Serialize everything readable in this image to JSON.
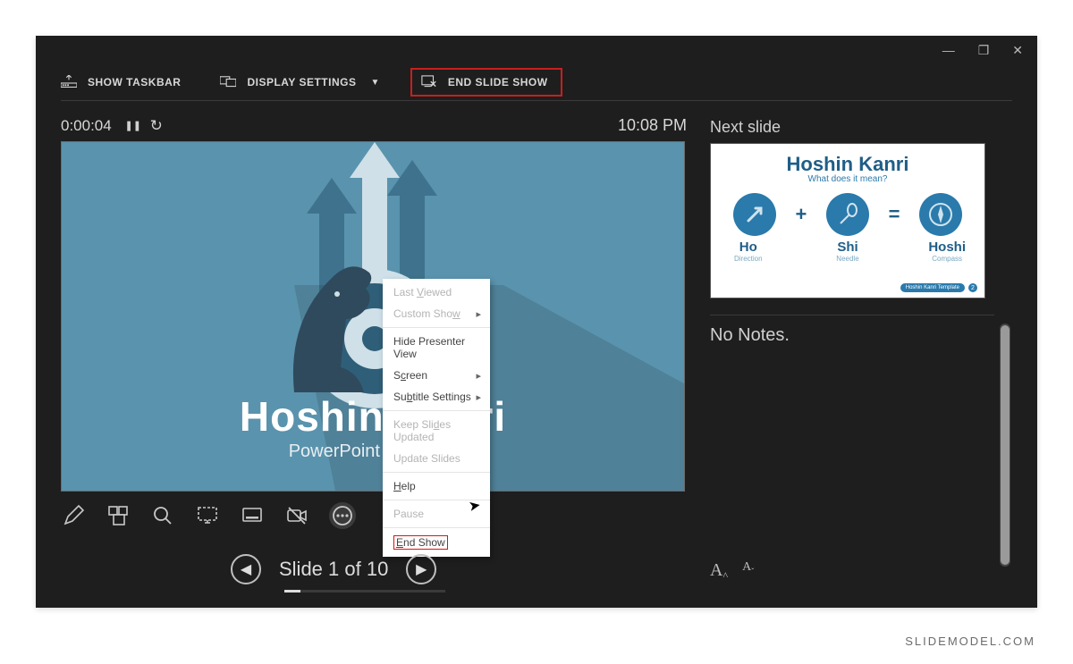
{
  "chrome": {
    "minimize": "—",
    "maximize": "❐",
    "close": "✕"
  },
  "topbar": {
    "show_taskbar": "SHOW TASKBAR",
    "display_settings": "DISPLAY SETTINGS",
    "end_slide_show": "END SLIDE SHOW"
  },
  "timer": {
    "elapsed": "0:00:04",
    "pause_glyph": "❚❚",
    "reset_glyph": "↻",
    "clock": "10:08 PM"
  },
  "main_slide": {
    "title": "Hoshin Kanri",
    "subtitle": "PowerPoint Template"
  },
  "context_menu": {
    "items": [
      {
        "label": "Last Viewed",
        "accel": "V",
        "disabled": true,
        "arrow": false
      },
      {
        "label": "Custom Show",
        "accel": "w",
        "disabled": true,
        "arrow": true
      },
      {
        "sep": true
      },
      {
        "label": "Hide Presenter View",
        "accel": "",
        "disabled": false,
        "arrow": false
      },
      {
        "label": "Screen",
        "accel": "c",
        "disabled": false,
        "arrow": true
      },
      {
        "label": "Subtitle Settings",
        "accel": "b",
        "disabled": false,
        "arrow": true
      },
      {
        "sep": true
      },
      {
        "label": "Keep Slides Updated",
        "accel": "d",
        "disabled": true,
        "arrow": false
      },
      {
        "label": "Update Slides",
        "accel": "",
        "disabled": true,
        "arrow": false
      },
      {
        "sep": true
      },
      {
        "label": "Help",
        "accel": "H",
        "disabled": false,
        "arrow": false
      },
      {
        "sep": true
      },
      {
        "label": "Pause",
        "accel": "",
        "disabled": true,
        "arrow": false
      },
      {
        "sep": true
      },
      {
        "label": "End Show",
        "accel": "E",
        "disabled": false,
        "arrow": false,
        "highlight": true
      }
    ]
  },
  "nav": {
    "label": "Slide 1 of 10",
    "prev": "◀",
    "next": "▶"
  },
  "right": {
    "next_slide_label": "Next slide",
    "thumb": {
      "title": "Hoshin Kanri",
      "subtitle": "What does it mean?",
      "c1": "Ho",
      "c1s": "Direction",
      "op1": "+",
      "c2": "Shi",
      "c2s": "Needle",
      "op2": "=",
      "c3": "Hoshi",
      "c3s": "Compass",
      "chip": "Hoshin Kanri Template"
    },
    "notes": "No Notes."
  },
  "watermark": "SLIDEMODEL.COM"
}
